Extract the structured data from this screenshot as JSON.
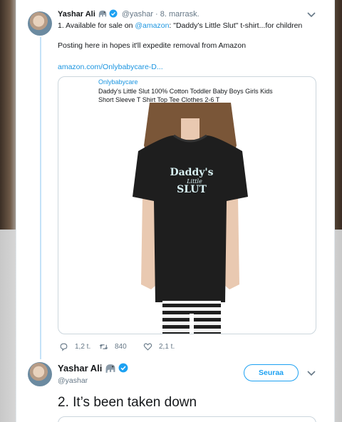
{
  "tweet1": {
    "name": "Yashar Ali",
    "handle": "@yashar",
    "date": "8. marrask.",
    "text_prefix": "1. Available for sale on ",
    "mention": "@amazon",
    "text_suffix": ": \"Daddy's Little Slut\" t-shirt...for children",
    "text2": "Posting here in hopes it'll expedite removal from Amazon",
    "url": "amazon.com/Onlybabycare-D...",
    "card": {
      "site": "Onlybabycare",
      "title": "Daddy's Little Slut 100% Cotton Toddler Baby Boys Girls Kids Short Sleeve T Shirt Top Tee Clothes 2-6 T",
      "shirt_line1": "Daddy's",
      "shirt_line2": "Little",
      "shirt_line3": "SLUT"
    },
    "actions": {
      "replies": "1,2 t.",
      "retweets": "840",
      "likes": "2,1 t."
    }
  },
  "tweet2": {
    "name": "Yashar Ali",
    "handle": "@yashar",
    "follow_label": "Seuraa",
    "text": "2. It’s been taken down"
  },
  "colors": {
    "accent": "#1da1f2",
    "link": "#1b95e0",
    "muted": "#657786",
    "thread_line": "#c4e2f8"
  },
  "icons": [
    "elephant-emoji-icon",
    "verified-badge-icon",
    "chevron-down-icon",
    "reply-icon",
    "retweet-icon",
    "like-icon"
  ]
}
